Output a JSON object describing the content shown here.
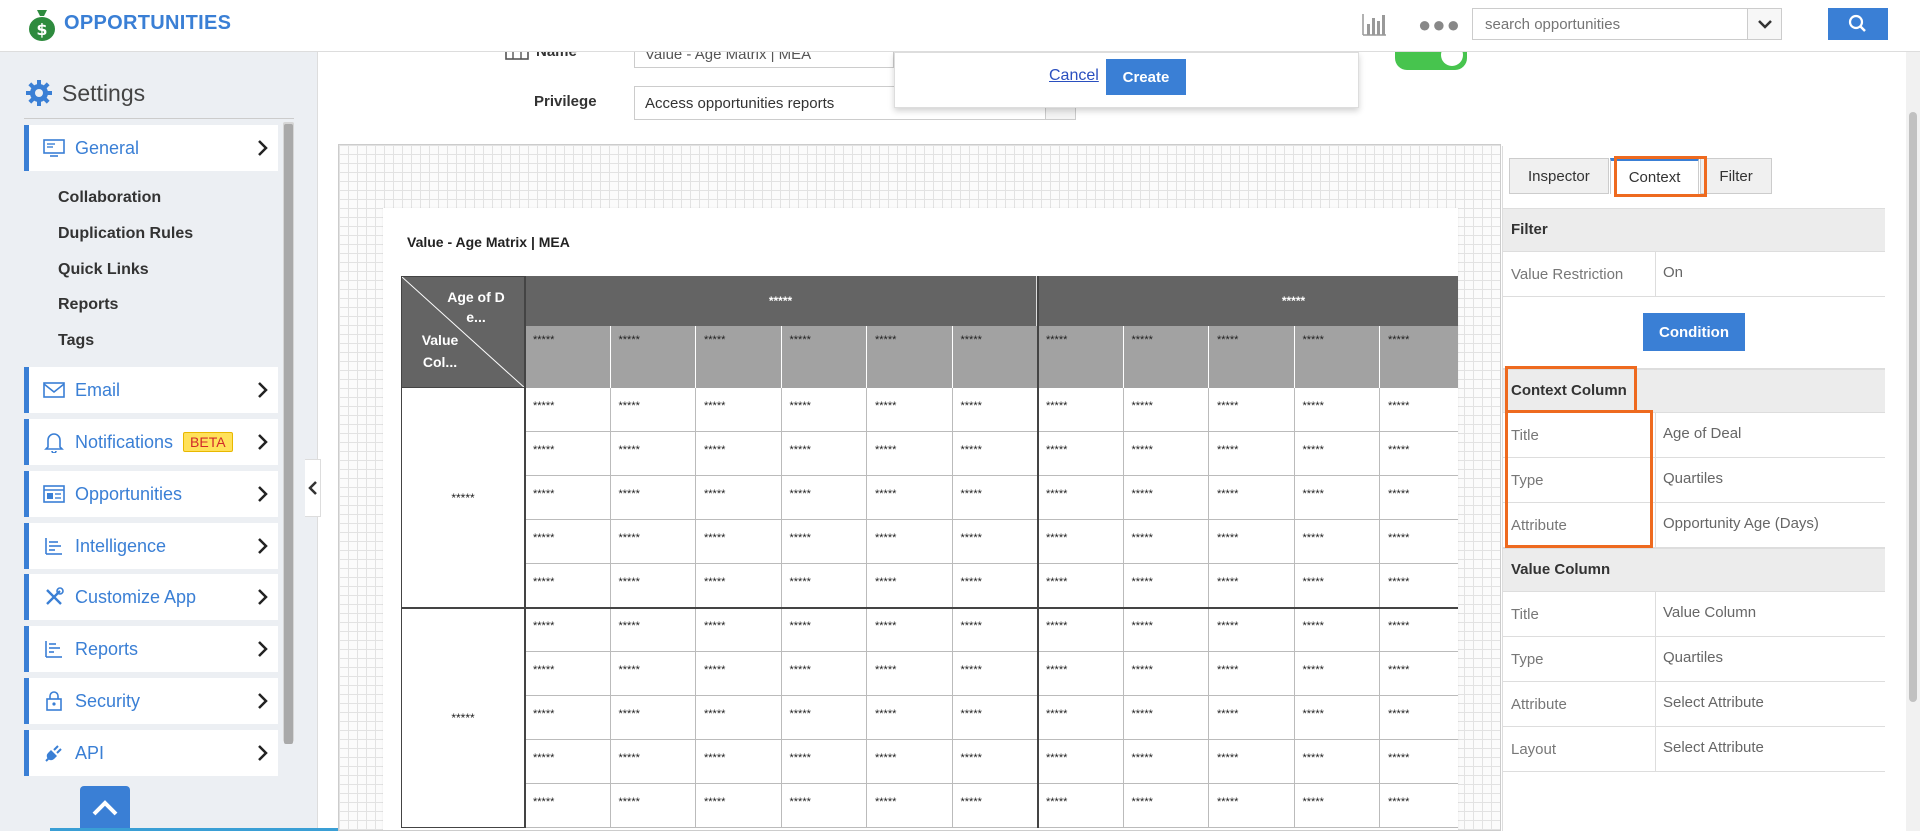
{
  "app": {
    "title": "OPPORTUNITIES"
  },
  "search": {
    "placeholder": "search opportunities"
  },
  "sidebar": {
    "header": "Settings",
    "general": "General",
    "sub_items": [
      "Collaboration",
      "Duplication Rules",
      "Quick Links",
      "Reports",
      "Tags"
    ],
    "items": [
      {
        "label": "Email",
        "icon": "envelope-icon"
      },
      {
        "label": "Notifications",
        "icon": "bell-icon",
        "badge": "BETA"
      },
      {
        "label": "Opportunities",
        "icon": "opportunities-icon"
      },
      {
        "label": "Intelligence",
        "icon": "intelligence-icon"
      },
      {
        "label": "Customize App",
        "icon": "tools-icon"
      },
      {
        "label": "Reports",
        "icon": "reports-icon"
      },
      {
        "label": "Security",
        "icon": "lock-icon"
      },
      {
        "label": "API",
        "icon": "plug-icon"
      }
    ]
  },
  "form": {
    "name_label": "Name",
    "name_value": "Value - Age Matrix | MEA",
    "privilege_label": "Privilege",
    "privilege_value": "Access opportunities reports"
  },
  "dialog": {
    "cancel": "Cancel",
    "create": "Create"
  },
  "report": {
    "title": "Value - Age Matrix | MEA",
    "corner_top": "Age of D e...",
    "corner_bottom": "Value Col...",
    "group_headers": [
      "*****",
      "*****"
    ],
    "masked": "*****"
  },
  "panel": {
    "tabs": [
      "Inspector",
      "Context",
      "Filter"
    ],
    "active_tab": "Context",
    "filter": {
      "header": "Filter",
      "value_restriction_label": "Value Restriction",
      "value_restriction_value": "On",
      "condition_button": "Condition"
    },
    "context_column": {
      "header": "Context Column",
      "rows": [
        {
          "label": "Title",
          "value": "Age of Deal"
        },
        {
          "label": "Type",
          "value": "Quartiles"
        },
        {
          "label": "Attribute",
          "value": "Opportunity Age (Days)"
        }
      ]
    },
    "value_column": {
      "header": "Value Column",
      "rows": [
        {
          "label": "Title",
          "value": "Value Column"
        },
        {
          "label": "Type",
          "value": "Quartiles"
        },
        {
          "label": "Attribute",
          "value": "Select Attribute"
        },
        {
          "label": "Layout",
          "value": "Select Attribute"
        }
      ]
    }
  },
  "colors": {
    "accent": "#3a7fd5",
    "highlight": "#ee6a1f",
    "toggle_on": "#47c44e",
    "header_dark": "#646464"
  }
}
